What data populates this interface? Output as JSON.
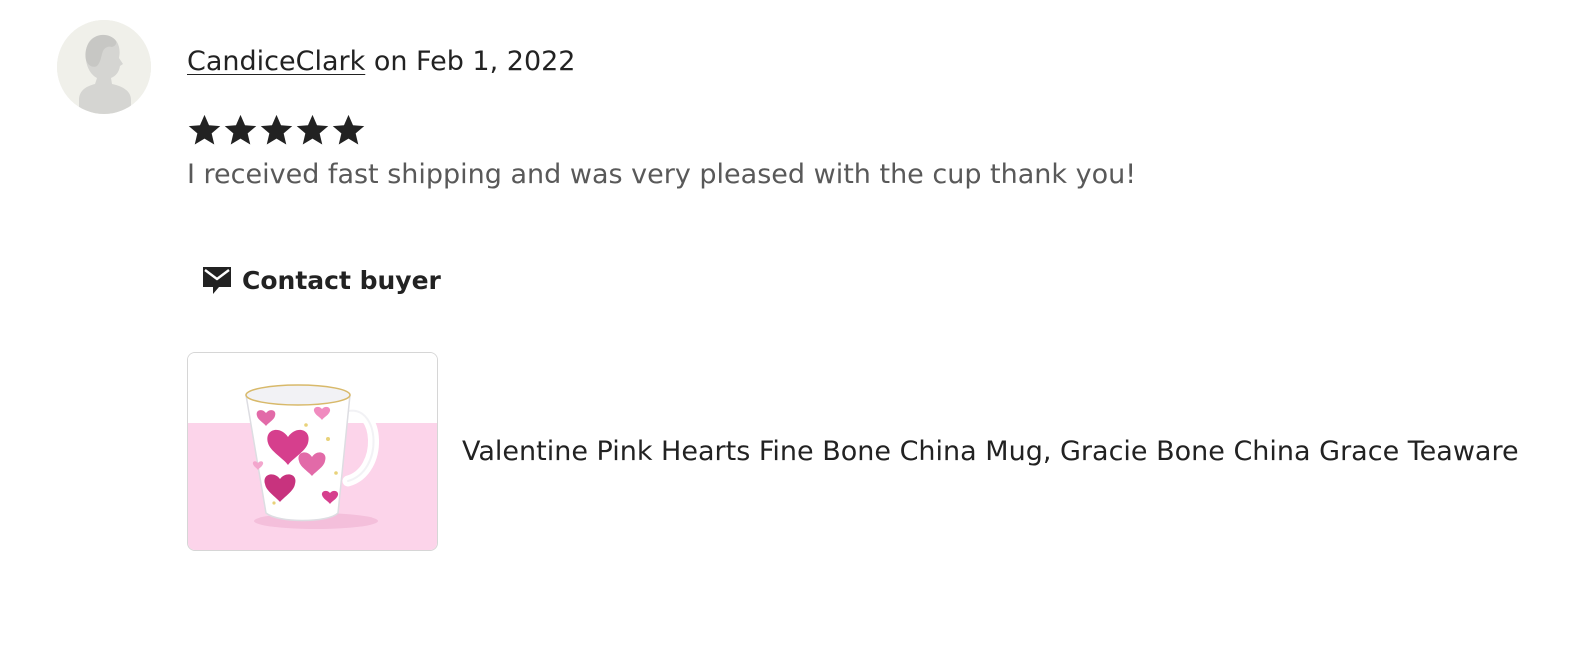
{
  "review": {
    "avatar_icon": "default-user-silhouette-icon",
    "reviewer_name": "CandiceClark",
    "date_text": " on Feb 1, 2022",
    "rating": 5,
    "rating_max": 5,
    "star_icon": "star-icon",
    "text": "I received fast shipping and was very pleased with the cup thank you!"
  },
  "actions": {
    "contact_buyer_label": "Contact buyer",
    "contact_buyer_icon": "message-icon"
  },
  "listing": {
    "title": "Valentine Pink Hearts Fine Bone China Mug, Gracie Bone China Grace Teaware",
    "image_icon": "mug-with-pink-hearts-image"
  },
  "colors": {
    "text": "#222222",
    "muted_text": "#595959",
    "avatar_bg": "#f0f0ea",
    "listing_pink_bg": "#fcd4ea",
    "heart_pink": "#e04a96"
  }
}
